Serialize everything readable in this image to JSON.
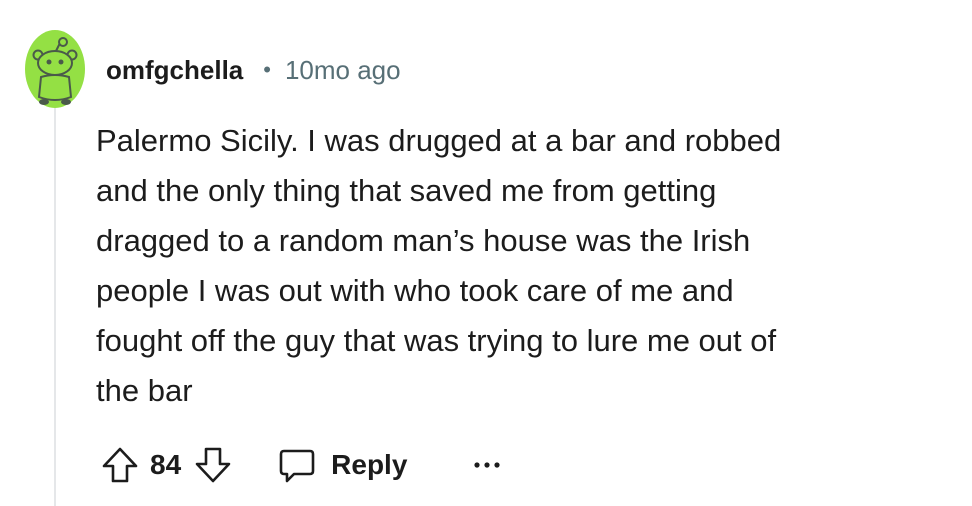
{
  "comment": {
    "username": "omfgchella",
    "separator": "•",
    "timestamp": "10mo ago",
    "body_lines": [
      "Palermo Sicily. I was drugged at a bar and robbed",
      "and the only thing that saved me from getting",
      "dragged to a random man’s house was the Irish",
      "people I was out with who took care of me and",
      "fought off the guy that was trying to lure me out of",
      "the bar"
    ]
  },
  "actions": {
    "upvote_icon": "arrow-up-outline-icon",
    "vote_count": "84",
    "downvote_icon": "arrow-down-outline-icon",
    "reply_icon": "speech-bubble-icon",
    "reply_label": "Reply",
    "more_icon": "ellipsis-icon"
  },
  "colors": {
    "avatar_bg": "#94e044",
    "text": "#1c1c1c",
    "meta": "#576f76",
    "thread_line": "#e5e7e9"
  }
}
